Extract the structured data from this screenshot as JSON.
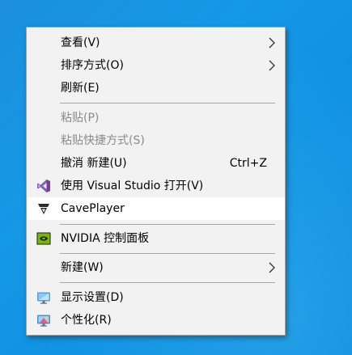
{
  "context_menu": {
    "items": [
      {
        "label": "查看(V)",
        "submenu": true,
        "icon": null,
        "enabled": true
      },
      {
        "label": "排序方式(O)",
        "submenu": true,
        "icon": null,
        "enabled": true
      },
      {
        "label": "刷新(E)",
        "submenu": false,
        "icon": null,
        "enabled": true
      },
      {
        "label": "粘贴(P)",
        "submenu": false,
        "icon": null,
        "enabled": false
      },
      {
        "label": "粘贴快捷方式(S)",
        "submenu": false,
        "icon": null,
        "enabled": false
      },
      {
        "label": "撤消 新建(U)",
        "shortcut": "Ctrl+Z",
        "submenu": false,
        "icon": null,
        "enabled": true
      },
      {
        "label": "使用 Visual Studio 打开(V)",
        "submenu": false,
        "icon": "visual-studio-icon",
        "enabled": true
      },
      {
        "label": "CavePlayer",
        "submenu": false,
        "icon": "caveplayer-icon",
        "enabled": true,
        "highlighted": true
      },
      {
        "label": "NVIDIA 控制面板",
        "submenu": false,
        "icon": "nvidia-icon",
        "enabled": true
      },
      {
        "label": "新建(W)",
        "submenu": true,
        "icon": null,
        "enabled": true
      },
      {
        "label": "显示设置(D)",
        "submenu": false,
        "icon": "display-settings-icon",
        "enabled": true
      },
      {
        "label": "个性化(R)",
        "submenu": false,
        "icon": "personalize-icon",
        "enabled": true
      }
    ]
  },
  "colors": {
    "desktop": "#1499e6",
    "menu_background": "#f2f2f2",
    "highlight": "#ffffff",
    "disabled_text": "#8a8a8a"
  }
}
